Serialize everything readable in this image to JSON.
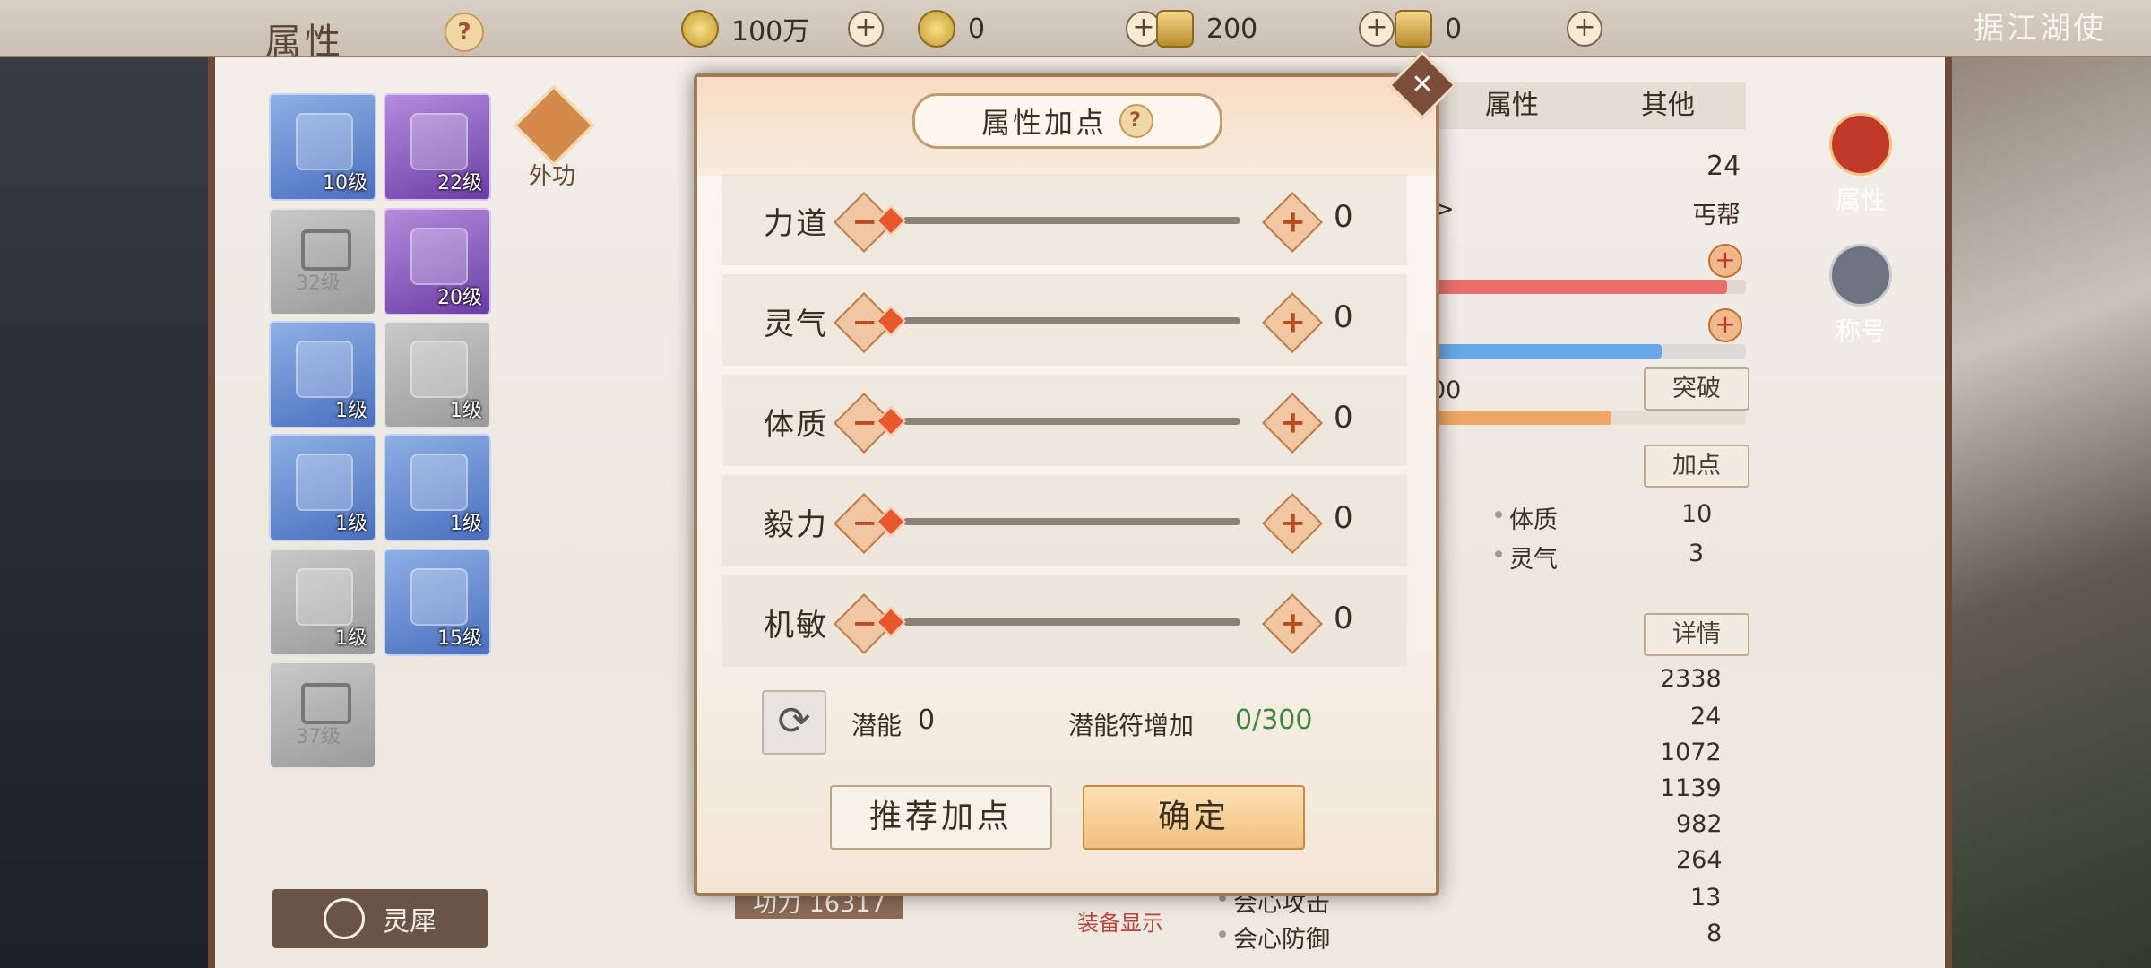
{
  "header": {
    "panel_title": "属性",
    "help": "?",
    "corner_title": "据江湖使",
    "currencies": [
      {
        "icon": "copper-coin-icon",
        "value": "100万"
      },
      {
        "icon": "gold-coin-icon",
        "value": "0"
      },
      {
        "icon": "silver-ingot-icon",
        "value": "200"
      },
      {
        "icon": "gold-ingot-icon",
        "value": "0"
      }
    ],
    "plus": "+"
  },
  "equipment": [
    {
      "level": "10级",
      "rarity": "blue",
      "icon": "dagger-icon"
    },
    {
      "level": "22级",
      "rarity": "purple",
      "icon": "armor-icon"
    },
    {
      "level": "32级",
      "rarity": "gray",
      "icon": "lock-icon"
    },
    {
      "level": "20级",
      "rarity": "purple",
      "icon": "costume-icon"
    },
    {
      "level": "1级",
      "rarity": "blue",
      "icon": "bracer-icon"
    },
    {
      "level": "1级",
      "rarity": "gray",
      "icon": "necklace-icon"
    },
    {
      "level": "1级",
      "rarity": "blue",
      "icon": "ring-ruby-icon"
    },
    {
      "level": "1级",
      "rarity": "blue",
      "icon": "ring-jade-icon"
    },
    {
      "level": "1级",
      "rarity": "gray",
      "icon": "boots-icon"
    },
    {
      "level": "15级",
      "rarity": "blue",
      "icon": "belt-icon"
    },
    {
      "level": "37级",
      "rarity": "gray",
      "icon": "lock-icon"
    }
  ],
  "waigong_label": "外功",
  "lingxi_label": "灵犀",
  "info_tabs": [
    "属性",
    "其他"
  ],
  "info": {
    "level": "24",
    "sect_arrow": ">",
    "sect": "丐帮",
    "partial_value": "00",
    "breakthrough_label": "突破",
    "addpoint_label": "加点",
    "detail_label": "详情",
    "attr_pairs": [
      {
        "name": "体质",
        "value": "10"
      },
      {
        "name": "灵气",
        "value": "3"
      }
    ],
    "numbers": [
      "2338",
      "24",
      "1072",
      "1139",
      "982",
      "264",
      "13",
      "8"
    ],
    "crit_attack": "会心攻击",
    "crit_defense": "会心防御",
    "power": "功力 16317",
    "equip_display": "装备显示"
  },
  "bars": {
    "hp_fill": 0.94,
    "mp_fill": 0.73,
    "exp_fill": 0.57
  },
  "right_nav": [
    {
      "label": "属性",
      "icon": "attribute-icon",
      "active": true
    },
    {
      "label": "称号",
      "icon": "title-icon",
      "active": false
    }
  ],
  "dialog": {
    "title": "属性加点",
    "help": "?",
    "close": "✕",
    "stats": [
      {
        "name": "力道",
        "value": "0"
      },
      {
        "name": "灵气",
        "value": "0"
      },
      {
        "name": "体质",
        "value": "0"
      },
      {
        "name": "毅力",
        "value": "0"
      },
      {
        "name": "机敏",
        "value": "0"
      }
    ],
    "minus": "−",
    "plus": "+",
    "potential_label": "潜能",
    "potential_value": "0",
    "charm_label": "潜能符增加",
    "charm_value": "0/300",
    "recommend_button": "推荐加点",
    "confirm_button": "确定",
    "refresh_glyph": "⟳"
  },
  "colors": {
    "accent": "#e8562e",
    "hp": "#e9706a",
    "mp": "#6aa7e6",
    "exp": "#f0a765",
    "charm": "#3a8a34"
  }
}
